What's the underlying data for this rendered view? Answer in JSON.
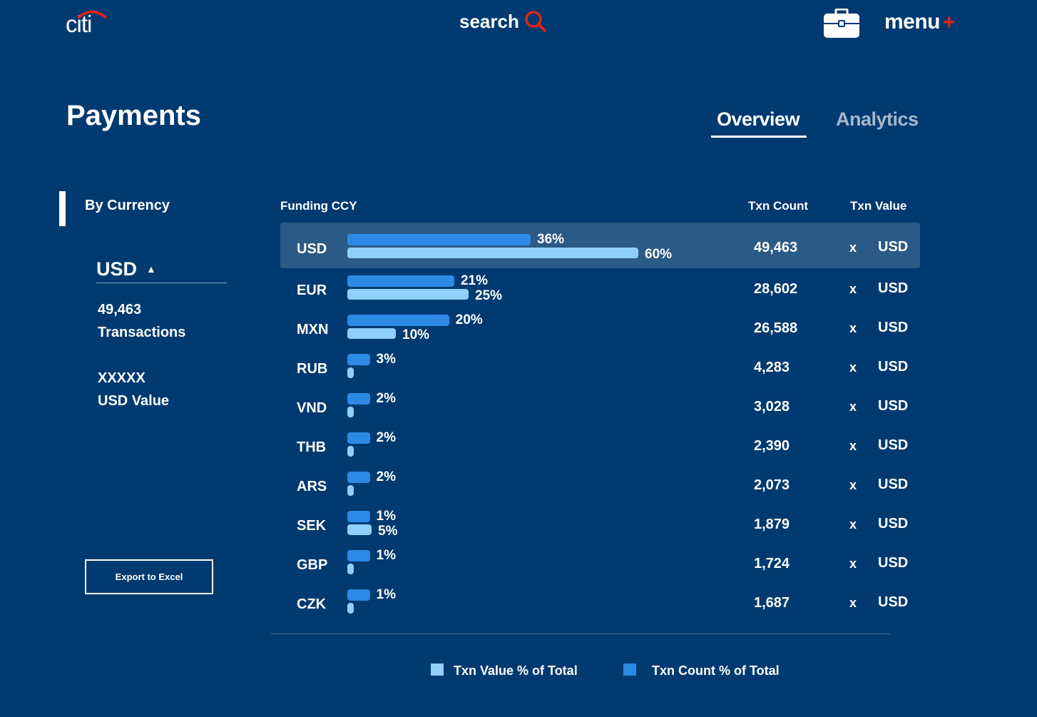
{
  "header": {
    "logo_text": "citi",
    "search_label": "search",
    "menu_label": "menu",
    "menu_plus": "+"
  },
  "page": {
    "title": "Payments",
    "tabs": [
      {
        "label": "Overview",
        "active": true
      },
      {
        "label": "Analytics",
        "active": false
      }
    ]
  },
  "sidebar": {
    "section_title": "By Currency",
    "selected_currency": "USD",
    "selected_arrow": "▲",
    "transactions_count": "49,463",
    "transactions_label": "Transactions",
    "usd_value": "XXXXX",
    "usd_value_label": "USD Value",
    "export_label": "Export to Excel"
  },
  "table": {
    "headers": {
      "ccy": "Funding CCY",
      "count": "Txn Count",
      "value": "Txn Value"
    },
    "rows": [
      {
        "ccy": "USD",
        "count_pct": 36,
        "value_pct": 60,
        "count_pct_label": "36%",
        "value_pct_label": "60%",
        "txn_count": "49,463",
        "x": "x",
        "txn_value": "USD",
        "selected": true
      },
      {
        "ccy": "EUR",
        "count_pct": 21,
        "value_pct": 25,
        "count_pct_label": "21%",
        "value_pct_label": "25%",
        "txn_count": "28,602",
        "x": "x",
        "txn_value": "USD"
      },
      {
        "ccy": "MXN",
        "count_pct": 20,
        "value_pct": 10,
        "count_pct_label": "20%",
        "value_pct_label": "10%",
        "txn_count": "26,588",
        "x": "x",
        "txn_value": "USD"
      },
      {
        "ccy": "RUB",
        "count_pct": 3,
        "value_pct": 0,
        "count_pct_label": "3%",
        "value_pct_label": "",
        "txn_count": "4,283",
        "x": "x",
        "txn_value": "USD"
      },
      {
        "ccy": "VND",
        "count_pct": 2,
        "value_pct": 0,
        "count_pct_label": "2%",
        "value_pct_label": "",
        "txn_count": "3,028",
        "x": "x",
        "txn_value": "USD"
      },
      {
        "ccy": "THB",
        "count_pct": 2,
        "value_pct": 0,
        "count_pct_label": "2%",
        "value_pct_label": "",
        "txn_count": "2,390",
        "x": "x",
        "txn_value": "USD"
      },
      {
        "ccy": "ARS",
        "count_pct": 2,
        "value_pct": 0,
        "count_pct_label": "2%",
        "value_pct_label": "",
        "txn_count": "2,073",
        "x": "x",
        "txn_value": "USD"
      },
      {
        "ccy": "SEK",
        "count_pct": 1,
        "value_pct": 5,
        "count_pct_label": "1%",
        "value_pct_label": "5%",
        "txn_count": "1,879",
        "x": "x",
        "txn_value": "USD"
      },
      {
        "ccy": "GBP",
        "count_pct": 1,
        "value_pct": 0,
        "count_pct_label": "1%",
        "value_pct_label": "",
        "txn_count": "1,724",
        "x": "x",
        "txn_value": "USD"
      },
      {
        "ccy": "CZK",
        "count_pct": 1,
        "value_pct": 0,
        "count_pct_label": "1%",
        "value_pct_label": "",
        "txn_count": "1,687",
        "x": "x",
        "txn_value": "USD"
      }
    ]
  },
  "legend": {
    "value_label": "Txn Value % of Total",
    "count_label": "Txn Count % of Total",
    "value_color": "#8fd0fa",
    "count_color": "#2d8ae4"
  },
  "colors": {
    "background": "#003a70",
    "accent_red": "#e2231a",
    "selected_row": "#2b5a86"
  }
}
